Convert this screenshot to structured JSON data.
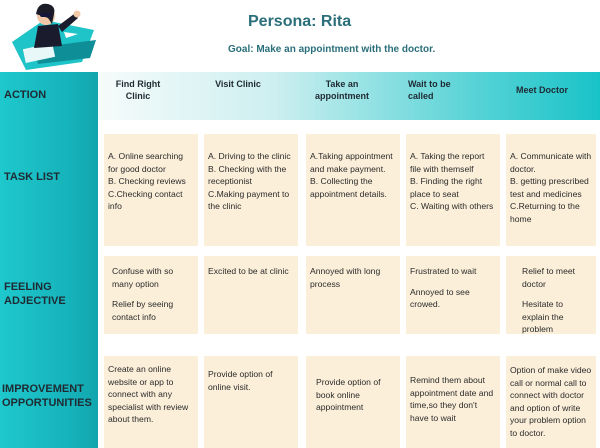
{
  "title": "Persona: Rita",
  "goal": "Goal: Make an appointment with the doctor.",
  "colors": {
    "accent": "#18c3c8",
    "title": "#2a6f7a",
    "card": "#fbefd9"
  },
  "row_labels": {
    "action": "ACTION",
    "task_list": "TASK LIST",
    "feeling_1": "FEELING",
    "feeling_2": "ADJECTIVE",
    "improvement_1": "IMPROVEMENT",
    "improvement_2": "OPPORTUNITIES"
  },
  "steps": [
    {
      "line1": "Find Right",
      "line2": "Clinic"
    },
    {
      "line1": "Visit Clinic",
      "line2": ""
    },
    {
      "line1": "Take an",
      "line2": "appointment"
    },
    {
      "line1": "Wait to be",
      "line2": "called"
    },
    {
      "line1": "Meet Doctor",
      "line2": ""
    }
  ],
  "task_list": [
    [
      "A. Online searching for good doctor",
      "B. Checking reviews",
      "C.Checking contact info"
    ],
    [
      "A. Driving to the clinic",
      "B. Checking with the receptionist",
      "C.Making payment to the clinic"
    ],
    [
      "A.Taking appointment and make payment.",
      "B. Collecting the appointment details."
    ],
    [
      "A. Taking the report file with themself",
      "B. Finding the right place to seat",
      "C. Waiting with others"
    ],
    [
      "A. Communicate with doctor.",
      "B. getting prescribed test and medicines",
      "C.Returning to the home"
    ]
  ],
  "feelings": [
    [
      "Confuse with so many option",
      "Relief by seeing contact info"
    ],
    [
      "Excited to be at clinic"
    ],
    [
      "Annoyed with long process"
    ],
    [
      "Frustrated to wait",
      "Annoyed to see crowed."
    ],
    [
      "Relief to meet doctor",
      "Hesitate to explain the problem"
    ]
  ],
  "improvements": [
    "Create an online website or app  to connect with any specialist with review about them.",
    "Provide option of online visit.",
    "Provide option of book online appointment",
    "Remind them about appointment date and time,so they don't have to wait",
    "Option of  make video call or normal call to connect with doctor and option of write your problem option to doctor."
  ]
}
